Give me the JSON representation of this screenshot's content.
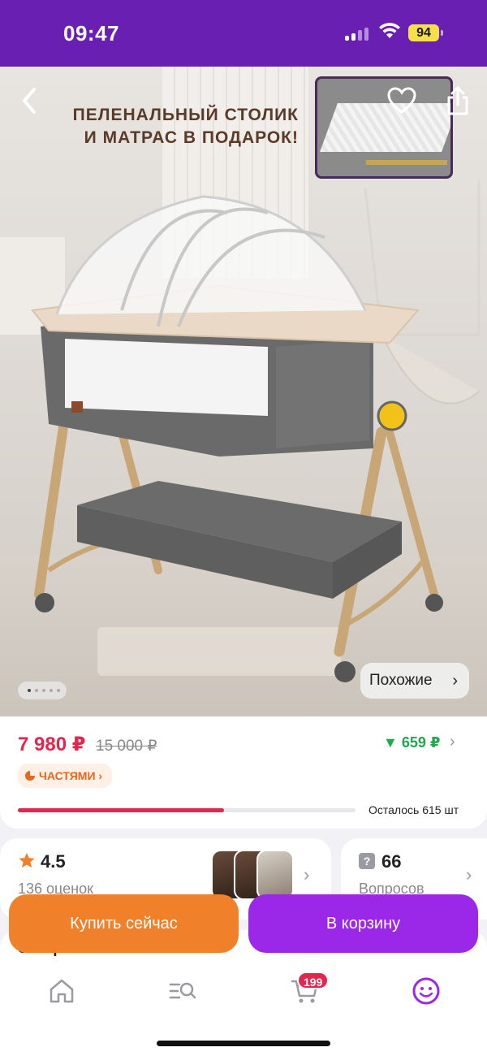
{
  "status_bar": {
    "time": "09:47",
    "battery": "94"
  },
  "hero": {
    "caption_line1": "ПЕЛЕНАЛЬНЫЙ СТОЛИК",
    "caption_line2": "И МАТРАС В ПОДАРОК!",
    "similar_label": "Похожие",
    "image_count": 5,
    "active_image": 1
  },
  "price": {
    "current": "7 980 ₽",
    "old": "15 000 ₽",
    "cashback": "▼ 659 ₽",
    "installments_label": "ЧАСТЯМИ",
    "stock_left": "Осталось 615 шт",
    "stock_progress_percent": 61
  },
  "rating": {
    "value": "4.5",
    "count": "136 оценок"
  },
  "questions": {
    "value": "66",
    "label": "Вопросов"
  },
  "under_row": {
    "left": "Завтра",
    "right": "Условия"
  },
  "actions": {
    "buy_now": "Купить сейчас",
    "add_to_cart": "В корзину"
  },
  "tabbar": {
    "cart_badge": "199"
  },
  "colors": {
    "brand_purple": "#6a1fb3",
    "cart_button": "#9b28e8",
    "buy_button": "#f0802a",
    "price_red": "#e3264d",
    "cashback_green": "#22a74a",
    "battery_yellow": "#f5e04a"
  },
  "icons": [
    "back-icon",
    "heart-icon",
    "share-icon",
    "star-icon",
    "question-icon",
    "home-icon",
    "catalog-search-icon",
    "cart-icon",
    "profile-icon"
  ]
}
